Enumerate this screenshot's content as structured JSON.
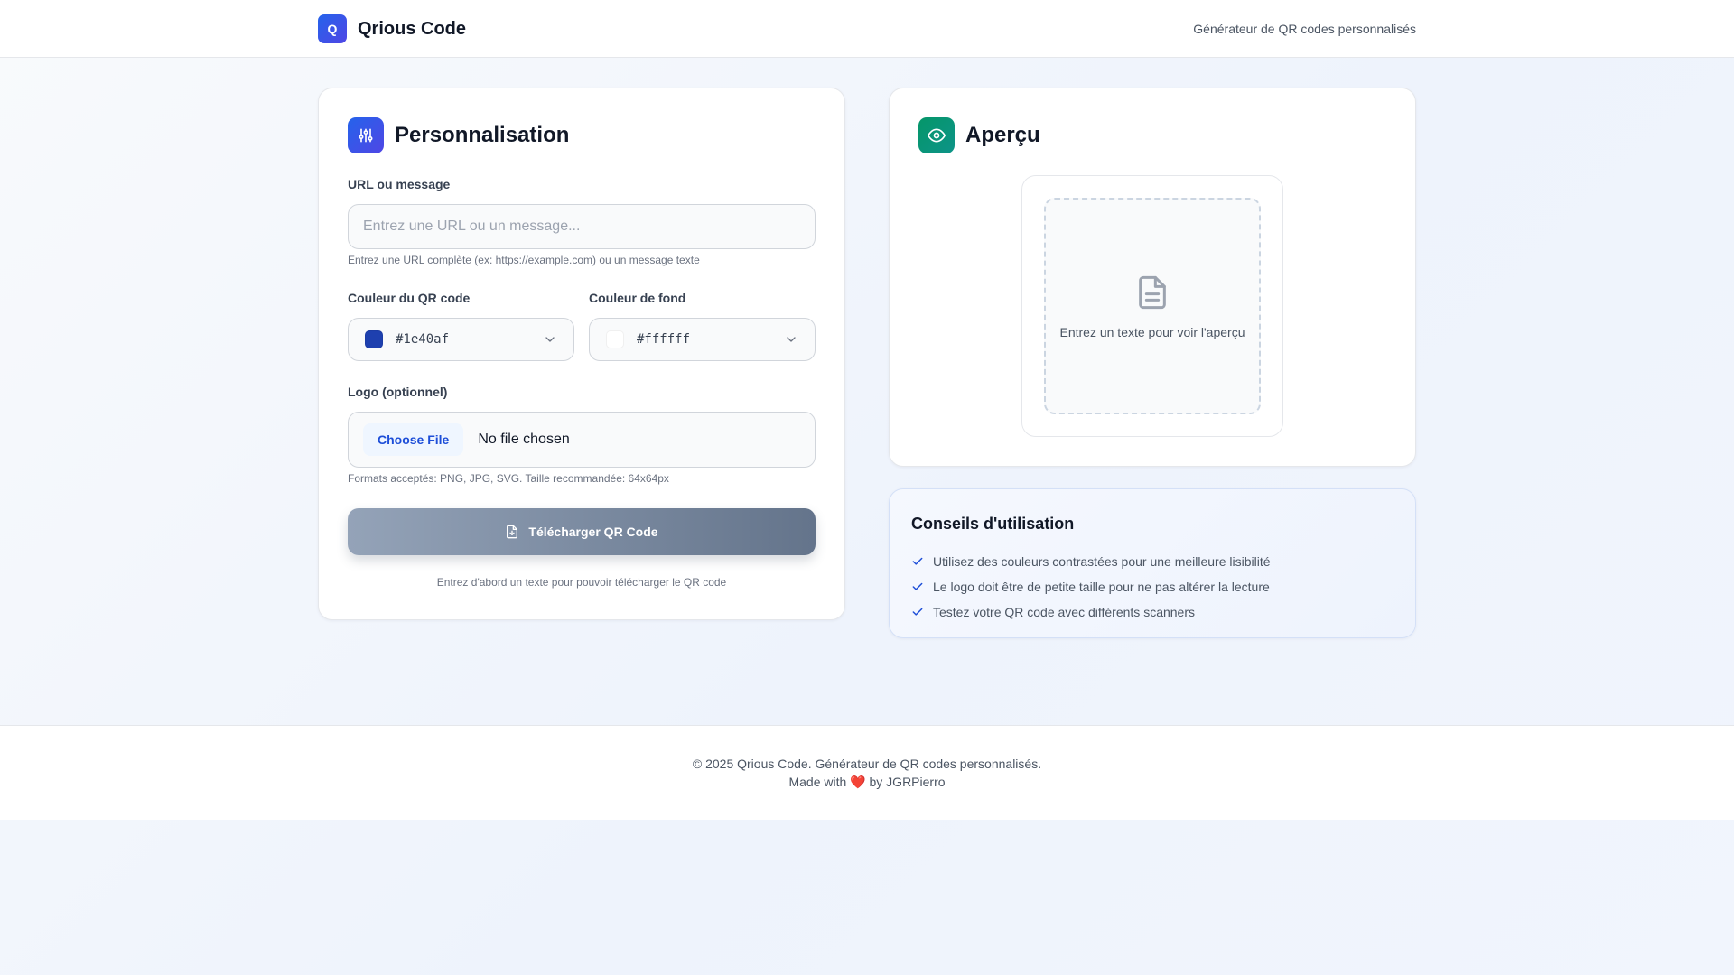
{
  "header": {
    "logo_letter": "Q",
    "brand": "Qrious Code",
    "tagline": "Générateur de QR codes personnalisés"
  },
  "customize": {
    "title": "Personnalisation",
    "url_label": "URL ou message",
    "url_placeholder": "Entrez une URL ou un message...",
    "url_value": "",
    "url_hint": "Entrez une URL complète (ex: https://example.com) ou un message texte",
    "qr_color_label": "Couleur du QR code",
    "qr_color_value": "#1e40af",
    "bg_color_label": "Couleur de fond",
    "bg_color_value": "#ffffff",
    "logo_label": "Logo (optionnel)",
    "file_button": "Choose File",
    "file_status": "No file chosen",
    "logo_hint": "Formats acceptés: PNG, JPG, SVG. Taille recommandée: 64x64px",
    "download_label": "Télécharger QR Code",
    "download_note": "Entrez d'abord un texte pour pouvoir télécharger le QR code"
  },
  "preview": {
    "title": "Aperçu",
    "empty_text": "Entrez un texte pour voir l'aperçu"
  },
  "tips": {
    "title": "Conseils d'utilisation",
    "items": [
      "Utilisez des couleurs contrastées pour une meilleure lisibilité",
      "Le logo doit être de petite taille pour ne pas altérer la lecture",
      "Testez votre QR code avec différents scanners"
    ]
  },
  "footer": {
    "copyright": "© 2025 Qrious Code. Générateur de QR codes personnalisés.",
    "made_prefix": "Made with",
    "heart": "❤️",
    "made_suffix": "by JGRPierro"
  },
  "colors": {
    "accent_blue": "#2563eb",
    "accent_green": "#059669",
    "disabled_button": "#64748b"
  },
  "icons": {
    "title_customize": "sliders-icon",
    "title_preview": "eye-icon",
    "preview_placeholder": "document-icon",
    "download": "file-download-icon",
    "tip_bullet": "check-icon",
    "select_arrow": "chevron-down-icon"
  }
}
